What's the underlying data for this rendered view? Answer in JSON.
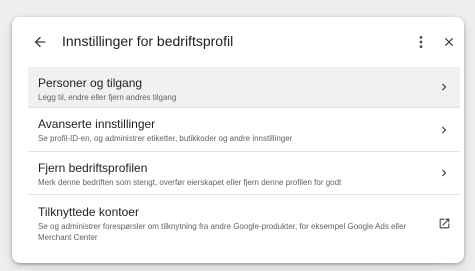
{
  "header": {
    "title": "Innstillinger for bedriftsprofil",
    "back_icon": "arrow-back-icon",
    "more_icon": "more-vert-icon",
    "close_icon": "close-icon"
  },
  "items": [
    {
      "title": "Personer og tilgang",
      "subtitle": "Legg til, endre eller fjern andres tilgang",
      "action_icon": "chevron-right-icon",
      "highlighted": true
    },
    {
      "title": "Avanserte innstillinger",
      "subtitle": "Se profil-ID-en, og administrer etiketter, butikkoder og andre innstillinger",
      "action_icon": "chevron-right-icon"
    },
    {
      "title": "Fjern bedriftsprofilen",
      "subtitle": "Merk denne bedriften som stengt, overfør eierskapet eller fjern denne profilen for godt",
      "action_icon": "chevron-right-icon"
    },
    {
      "title": "Tilknyttede kontoer",
      "subtitle": "Se og administrer forespørsler om tilknytning fra andre Google-produkter, for eksempel Google Ads eller Merchant Center",
      "action_icon": "open-in-new-icon"
    }
  ],
  "colors": {
    "text_primary": "#202124",
    "text_secondary": "#5f6368",
    "icon": "#3c4043",
    "divider": "#e3e3e3",
    "row_highlight": "#f1f1f1"
  }
}
